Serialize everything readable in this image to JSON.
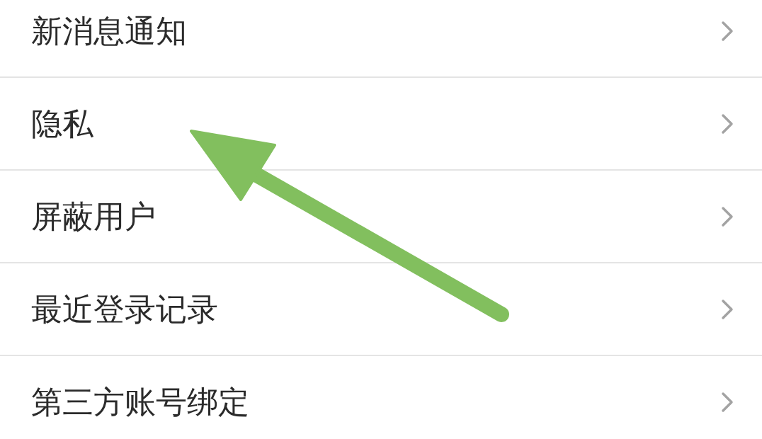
{
  "settings_list": [
    {
      "label": "新消息通知"
    },
    {
      "label": "隐私"
    },
    {
      "label": "屏蔽用户"
    },
    {
      "label": "最近登录记录"
    },
    {
      "label": "第三方账号绑定"
    }
  ]
}
